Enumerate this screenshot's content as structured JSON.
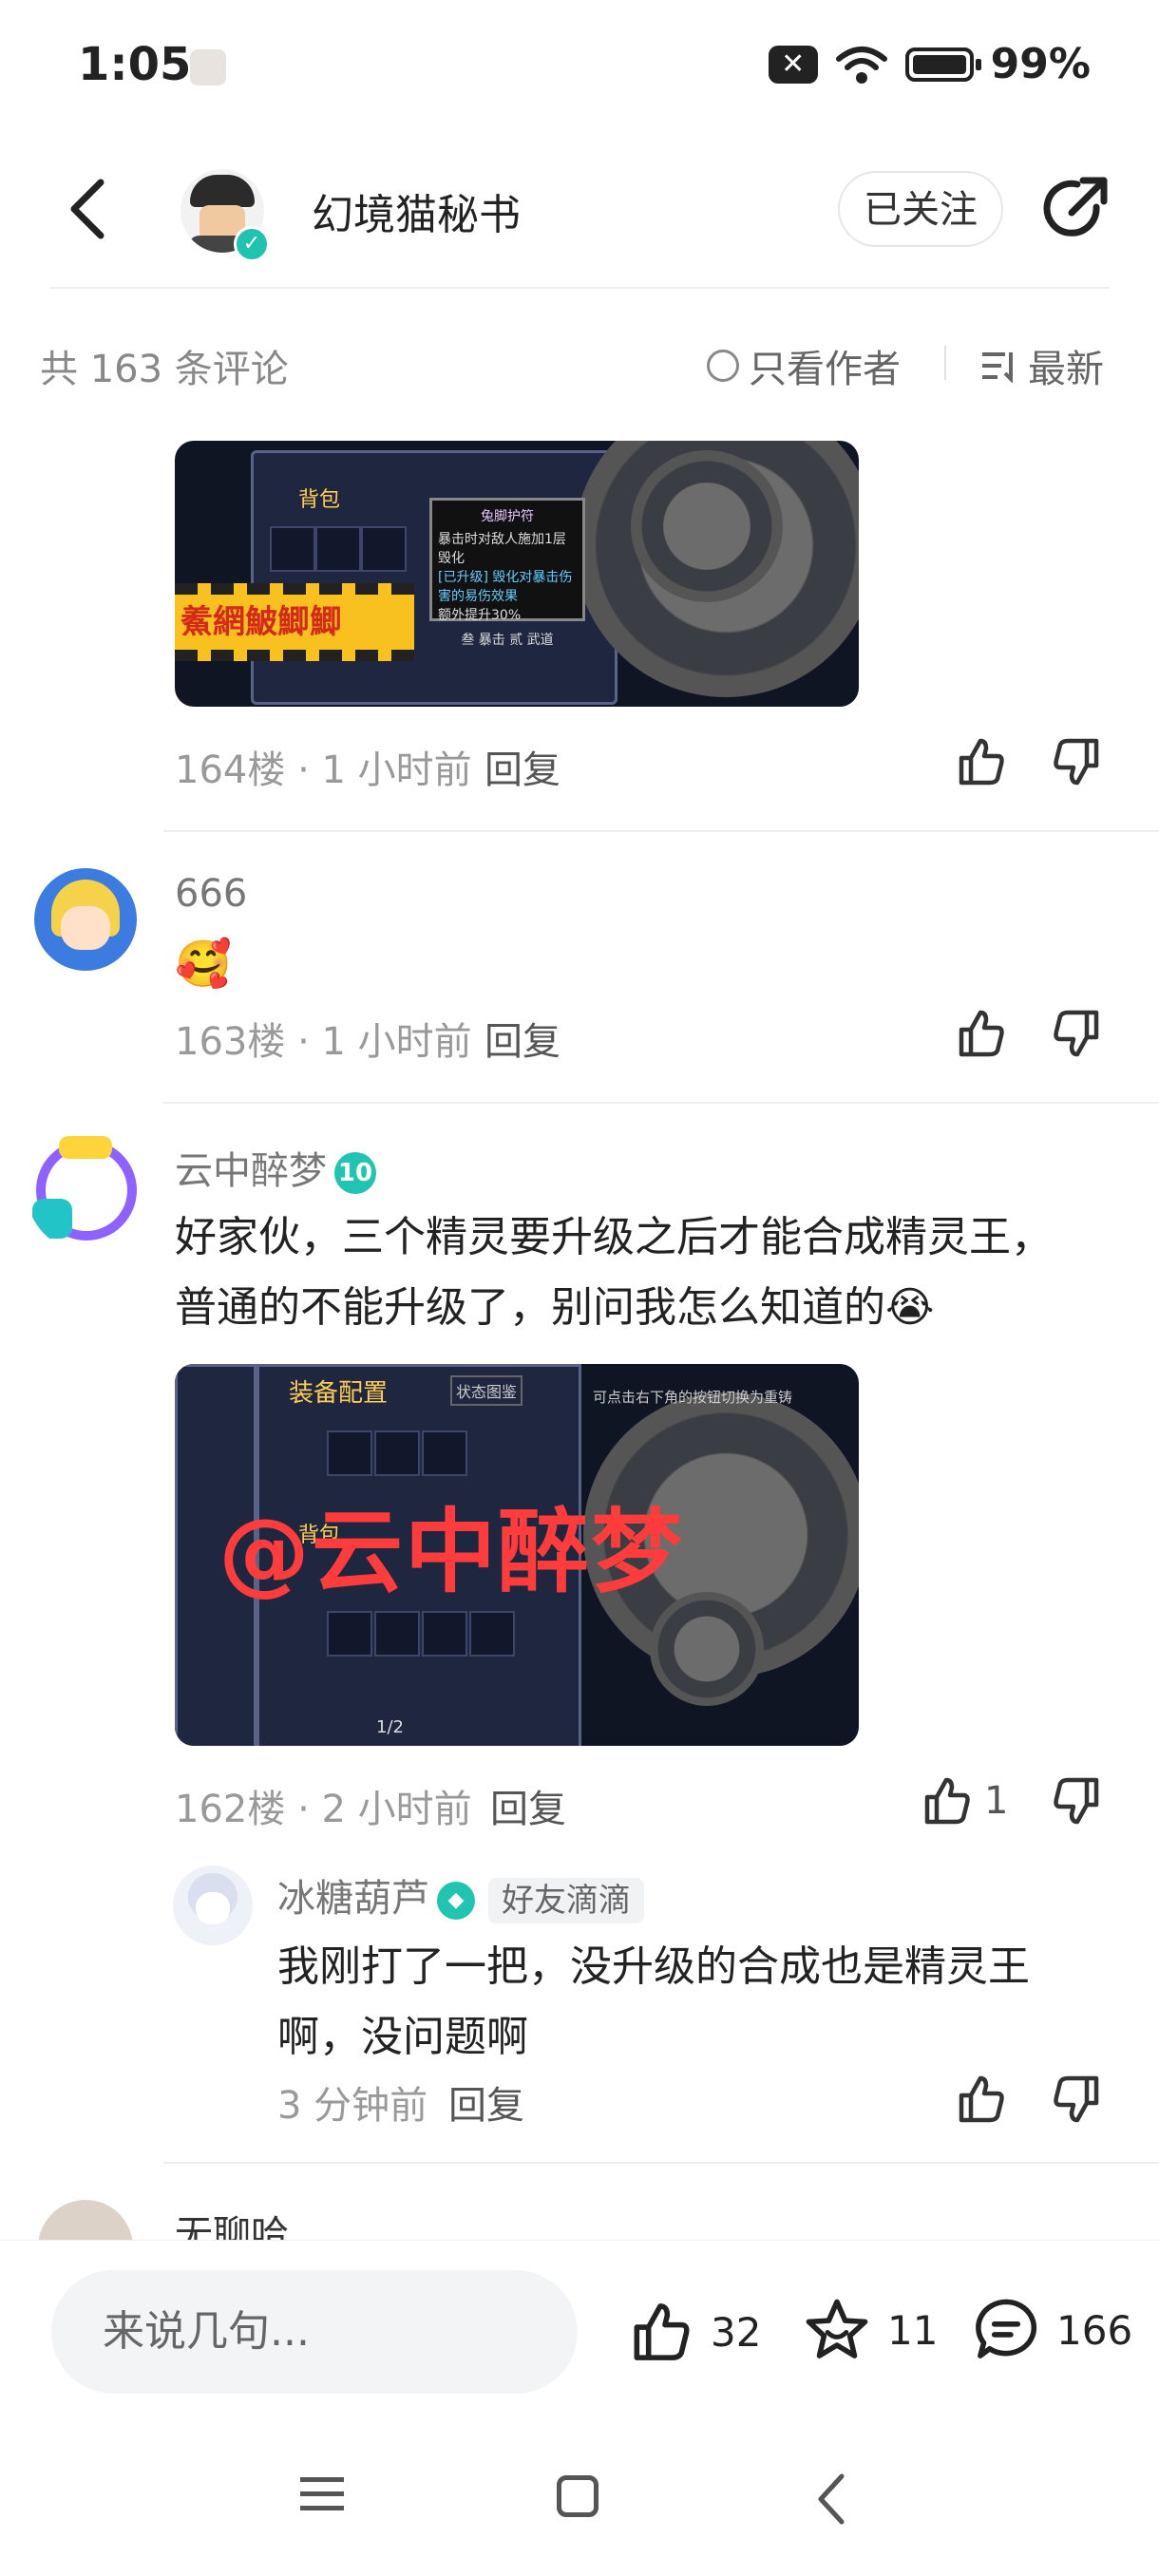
{
  "status_bar": {
    "time": "1:05",
    "battery": "99%"
  },
  "header": {
    "author_name": "幻境猫秘书",
    "follow_label": "已关注"
  },
  "comment_bar": {
    "count_text": "共 163 条评论",
    "author_only_label": "只看作者",
    "sort_label": "最新"
  },
  "comments": [
    {
      "floor": "164楼",
      "time": "1 小时前",
      "reply_label": "回复",
      "image": {
        "banner_text": "鮺網鮍鯽鯽",
        "panel_title": "背包",
        "popup_title": "兔脚护符",
        "popup_lines": [
          "暴击时对敌人施加1层毁化",
          "[已升级] 毁化对暴击伤害的易伤效果",
          "额外提升30%"
        ],
        "popup_footer": "叁 暴击   贰 武道"
      }
    },
    {
      "name": "666",
      "emoji": "🥰",
      "floor": "163楼",
      "time": "1 小时前",
      "reply_label": "回复"
    },
    {
      "name": "云中醉梦",
      "level": "10",
      "text": "好家伙，三个精灵要升级之后才能合成精灵王，普通的不能升级了，别问我怎么知道的😭",
      "image": {
        "watermark": "@云中醉梦",
        "panel_title": "装备配置",
        "sub_title": "背包",
        "hint": "可点击右下角的按钮切换为重铸",
        "page": "1/2",
        "state_label": "状态图鉴"
      },
      "floor": "162楼",
      "time": "2 小时前",
      "reply_label": "回复",
      "likes": "1",
      "replies": [
        {
          "name": "冰糖葫芦",
          "badge": "好友滴滴",
          "text": "我刚打了一把，没升级的合成也是精灵王啊，没问题啊",
          "time": "3 分钟前",
          "reply_label": "回复"
        }
      ]
    },
    {
      "name": "无聊哈"
    }
  ],
  "bottom_bar": {
    "input_placeholder": "来说几句...",
    "likes": "32",
    "favorites": "11",
    "comments": "166"
  }
}
